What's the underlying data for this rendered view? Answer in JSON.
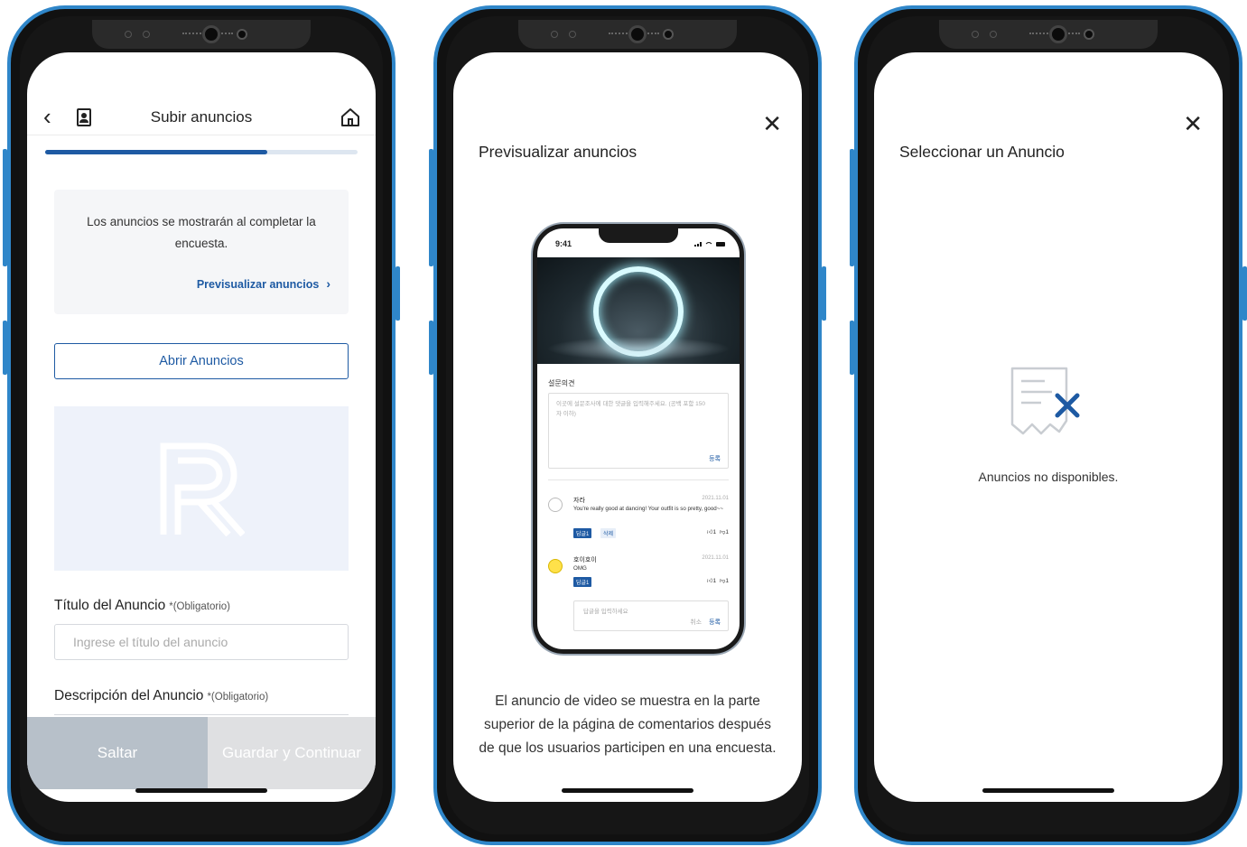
{
  "screen1": {
    "header": {
      "title": "Subir anuncios"
    },
    "progress": {
      "fraction": 0.71
    },
    "info": {
      "text": "Los anuncios se mostrarán al completar la encuesta.",
      "link": "Previsualizar anuncios"
    },
    "open_ads_button": "Abrir Anuncios",
    "ad_title": {
      "label": "Título del Anuncio",
      "required": "*(Obligatorio)",
      "placeholder": "Ingrese el título del anuncio"
    },
    "ad_description": {
      "label": "Descripción del Anuncio",
      "required": "*(Obligatorio)"
    },
    "skip_button": "Saltar",
    "save_button": "Guardar y Continuar"
  },
  "screen2": {
    "title": "Previsualizar anuncios",
    "close": "✕",
    "preview": {
      "time": "9:41",
      "section_label": "설문의견",
      "textarea_placeholder": "이곳에 설문조사에 대한 댓글을 입력해주세요. (공백 포함 150자 이하)",
      "register": "등록",
      "comments": [
        {
          "name": "자라",
          "date": "2021.11.01",
          "body": "You're really good at dancing! Your outfit is so pretty, good~~",
          "tags": [
            "답글1",
            "삭제"
          ],
          "likes": "1",
          "dislikes": "1"
        },
        {
          "name": "호이호이",
          "date": "2021.11.01",
          "body": "OMG",
          "tags": [
            "답글1"
          ],
          "likes": "1",
          "dislikes": "1"
        }
      ],
      "reply_placeholder": "답글을 입력하세요",
      "reply_cancel": "취소",
      "reply_register": "등록"
    },
    "description": "El anuncio de video se muestra en la parte superior de la página de comentarios después de que los usuarios participen en una encuesta."
  },
  "screen3": {
    "title": "Seleccionar un Anuncio",
    "close": "✕",
    "icon": "no-ads-receipt-icon",
    "message": "Anuncios no disponibles."
  },
  "colors": {
    "frame": "#2f86c9",
    "accent": "#1e5aa3",
    "skip_bg": "#b7c0c9",
    "save_bg": "#dfe0e2"
  }
}
